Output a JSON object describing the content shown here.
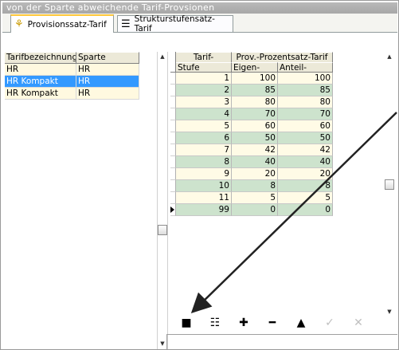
{
  "window": {
    "caption": "von der Sparte abweichende Tarif-Provsionen"
  },
  "tabs": [
    {
      "label": "Provisionssatz-Tarif",
      "icon": "award-icon",
      "active": true
    },
    {
      "label": "Strukturstufensatz-Tarif",
      "icon": "document-icon",
      "active": false
    }
  ],
  "left_table": {
    "headers": [
      "Tarifbezeichnung",
      "Sparte"
    ],
    "rows": [
      {
        "tarif": "HR",
        "sparte": "HR"
      },
      {
        "tarif": "HR Kompakt",
        "sparte": "HR"
      },
      {
        "tarif": "HR Kompakt",
        "sparte": "HR"
      }
    ],
    "selected_index": 1
  },
  "right_table": {
    "group_header_1": "Tarif-",
    "group_header_2": "Prov.-Prozentsatz-Tarif",
    "headers": [
      "Stufe",
      "Eigen-",
      "Anteil-"
    ],
    "rows": [
      [
        "1",
        "100",
        "100"
      ],
      [
        "2",
        "85",
        "85"
      ],
      [
        "3",
        "80",
        "80"
      ],
      [
        "4",
        "70",
        "70"
      ],
      [
        "5",
        "60",
        "60"
      ],
      [
        "6",
        "50",
        "50"
      ],
      [
        "7",
        "42",
        "42"
      ],
      [
        "8",
        "40",
        "40"
      ],
      [
        "9",
        "20",
        "20"
      ],
      [
        "10",
        "8",
        "8"
      ],
      [
        "11",
        "5",
        "5"
      ],
      [
        "99",
        "0",
        "0"
      ]
    ],
    "current_row_index": 11
  },
  "toolbar": [
    {
      "name": "new-record-button",
      "icon": "new-document-icon",
      "glyph": "■",
      "enabled": true
    },
    {
      "name": "edit-record-button",
      "icon": "list-document-icon",
      "glyph": "☷",
      "enabled": true
    },
    {
      "name": "insert-button",
      "icon": "plus-icon",
      "glyph": "✚",
      "enabled": true
    },
    {
      "name": "delete-button",
      "icon": "minus-icon",
      "glyph": "━",
      "enabled": true
    },
    {
      "name": "move-up-button",
      "icon": "triangle-up-icon",
      "glyph": "▲",
      "enabled": true
    },
    {
      "name": "confirm-button",
      "icon": "checkmark-icon",
      "glyph": "✓",
      "enabled": false
    },
    {
      "name": "cancel-button",
      "icon": "x-icon",
      "glyph": "✕",
      "enabled": false
    }
  ],
  "colors": {
    "selection": "#3399ff",
    "row_odd": "#fffbe6",
    "row_even": "#cde3cd",
    "annotation_arrow": "#222222"
  }
}
